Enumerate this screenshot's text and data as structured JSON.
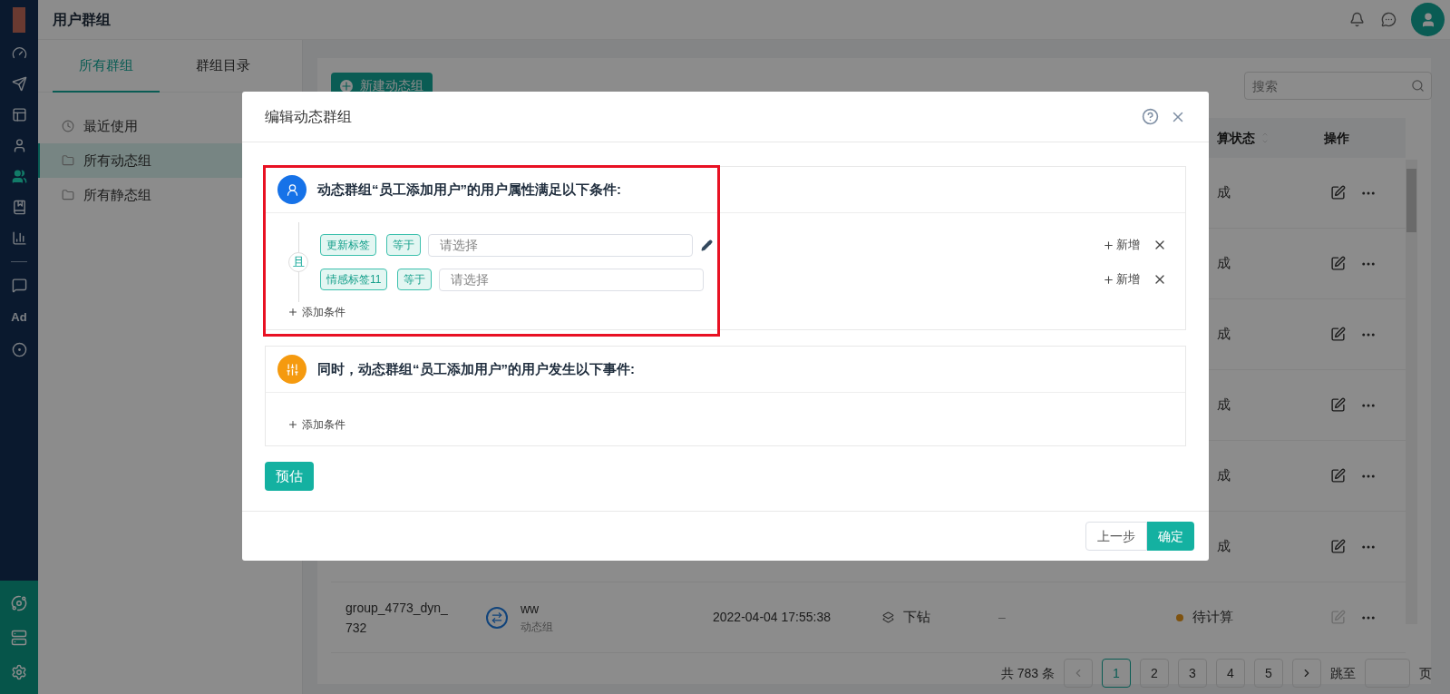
{
  "header": {
    "title": "用户群组"
  },
  "nav": {
    "items": [
      {
        "kind": "gauge",
        "selected": false
      },
      {
        "kind": "send",
        "selected": false
      },
      {
        "kind": "layout",
        "selected": false
      },
      {
        "kind": "user",
        "selected": false
      },
      {
        "kind": "users",
        "selected": true
      },
      {
        "kind": "bookmark",
        "selected": false
      },
      {
        "kind": "chart",
        "selected": false
      },
      {
        "kind": "divider"
      },
      {
        "kind": "chat",
        "selected": false
      },
      {
        "kind": "text",
        "label": "Ad",
        "selected": false
      },
      {
        "kind": "target",
        "selected": false
      }
    ],
    "bottom_items": [
      {
        "kind": "orbit"
      },
      {
        "kind": "server"
      },
      {
        "kind": "settings"
      }
    ]
  },
  "side_panel": {
    "tabs": [
      {
        "label": "所有群组",
        "selected": true
      },
      {
        "label": "群组目录",
        "selected": false
      }
    ],
    "items": [
      {
        "kind": "clock",
        "label": "最近使用",
        "selected": false
      },
      {
        "kind": "folder",
        "label": "所有动态组",
        "selected": true
      },
      {
        "kind": "folder",
        "label": "所有静态组",
        "selected": false
      }
    ]
  },
  "toolbar": {
    "new_button": "新建动态组",
    "search": {
      "placeholder": "搜索"
    }
  },
  "table": {
    "columns": [
      {
        "label": "算状态",
        "sortable": true
      },
      {
        "label": "操作",
        "sortable": false
      }
    ],
    "rows": [
      {
        "status": "成",
        "edit_disabled": false
      },
      {
        "status": "成",
        "edit_disabled": false
      },
      {
        "status": "成",
        "edit_disabled": false
      },
      {
        "status": "成",
        "edit_disabled": false
      },
      {
        "status": "成",
        "edit_disabled": false
      },
      {
        "status": "成",
        "edit_disabled": false
      },
      {
        "name": "group_4773_dyn_732",
        "group_name": "ww",
        "group_type": "动态组",
        "created": "2022-04-04 17:55:38",
        "mode": "下钻",
        "column_6": "–",
        "status": "待计算",
        "color": "#7e520f",
        "edit_disabled": true
      }
    ]
  },
  "pagination": {
    "total": "共 783 条",
    "pages": [
      {
        "label": "1",
        "selected": true
      },
      {
        "label": "2",
        "selected": false
      },
      {
        "label": "3",
        "selected": false
      },
      {
        "label": "4",
        "selected": false
      },
      {
        "label": "5",
        "selected": false
      }
    ],
    "jump_label": "跳至",
    "page_suffix": "页"
  },
  "dialog": {
    "title": "编辑动态群组",
    "sections": [
      {
        "kind": "attributes",
        "title": "动态群组“员工添加用户”的用户属性满足以下条件:",
        "connector": "且",
        "conditions": [
          {
            "field": "更新标签",
            "operator": "等于",
            "placeholder": "请选择",
            "edit_icon": true,
            "add_label": "新增"
          },
          {
            "field": "情感标签11",
            "operator": "等于",
            "placeholder": "请选择",
            "edit_icon": false,
            "add_label": "新增"
          }
        ],
        "add_condition": "添加条件"
      },
      {
        "kind": "events",
        "title": "同时，动态群组“员工添加用户”的用户发生以下事件:",
        "add_condition": "添加条件"
      }
    ],
    "estimate_button": "预估",
    "footer_buttons": [
      {
        "label": "上一步",
        "kind": "secondary"
      },
      {
        "label": "确定",
        "kind": "primary"
      }
    ]
  }
}
